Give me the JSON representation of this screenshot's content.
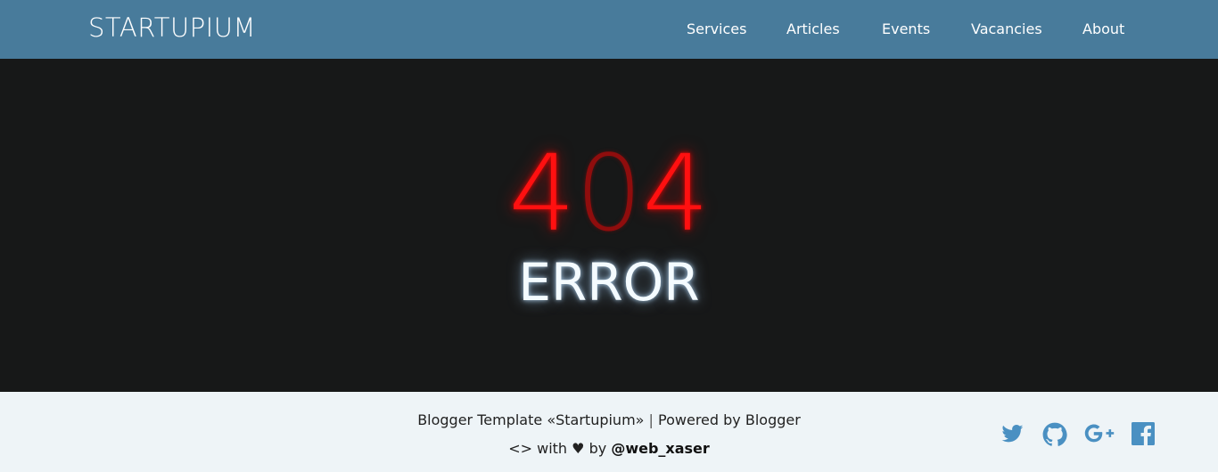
{
  "header": {
    "logo": "STARTUPIUM",
    "nav": [
      {
        "label": "Services"
      },
      {
        "label": "Articles"
      },
      {
        "label": "Events"
      },
      {
        "label": "Vacancies"
      },
      {
        "label": "About"
      }
    ]
  },
  "hero": {
    "code_digits": [
      "4",
      "0",
      "4"
    ],
    "error_label": "ERROR"
  },
  "footer": {
    "template_text": "Blogger Template «Startupium»",
    "separator": "|",
    "powered_text": "Powered by Blogger",
    "code_symbol": "<>",
    "with_text": "with",
    "heart_symbol": "♥",
    "by_text": "by",
    "author": "@web_xaser",
    "social": [
      {
        "icon": "twitter-icon"
      },
      {
        "icon": "github-icon"
      },
      {
        "icon": "google-plus-icon"
      },
      {
        "icon": "facebook-icon"
      }
    ]
  },
  "colors": {
    "header_bg": "#487b9b",
    "hero_bg": "#171818",
    "footer_bg": "#eef4f7",
    "error_red": "#ff1010",
    "dim_red": "#8f0d0d",
    "social_blue": "#4a90c2"
  }
}
